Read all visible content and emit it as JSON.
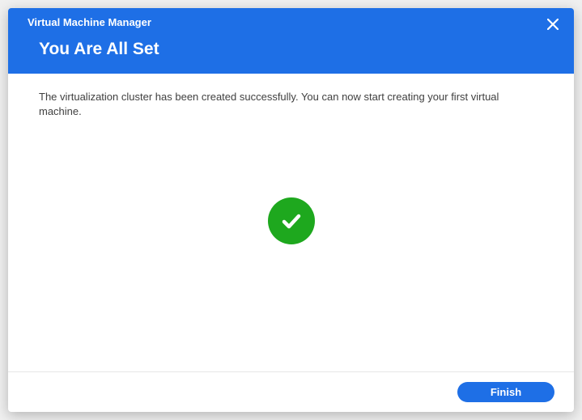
{
  "header": {
    "app_title": "Virtual Machine Manager",
    "page_title": "You Are All Set"
  },
  "content": {
    "message": "The virtualization cluster has been created successfully. You can now start creating your first virtual machine."
  },
  "footer": {
    "finish_label": "Finish"
  },
  "icons": {
    "close": "close-icon",
    "success": "check-icon"
  },
  "colors": {
    "primary": "#1e6fe6",
    "success": "#1ea81e"
  }
}
